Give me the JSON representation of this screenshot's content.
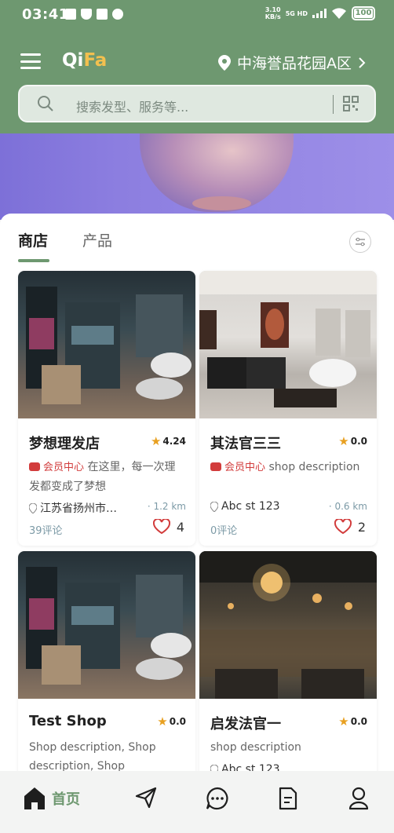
{
  "status_bar": {
    "time": "03:41",
    "net_speed_value": "3.10",
    "net_speed_unit": "KB/s",
    "signal_label": "5G HD",
    "battery": "100"
  },
  "header": {
    "logo_part1": "Qi",
    "logo_part2": "Fa",
    "location": "中海誉品花园A区",
    "search_placeholder": "搜索发型、服务等..."
  },
  "tabs": [
    {
      "label": "商店",
      "active": true
    },
    {
      "label": "产品",
      "active": false
    }
  ],
  "shops": [
    {
      "name": "梦想理发店",
      "rating": "4.24",
      "member_label": "会员中心",
      "description": "在这里，每一次理发都变成了梦想",
      "address": "江苏省扬州市…",
      "distance": "· 1.2 km",
      "reviews": "39评论",
      "likes": "4"
    },
    {
      "name": "其法官三三",
      "rating": "0.0",
      "member_label": "会员中心",
      "description": "shop description",
      "address": "Abc st 123",
      "distance": "· 0.6 km",
      "reviews": "0评论",
      "likes": "2"
    },
    {
      "name": "Test Shop",
      "rating": "0.0",
      "description": "Shop description, Shop description, Shop"
    },
    {
      "name": "启发法官一",
      "rating": "0.0",
      "description": "shop description",
      "address": "Abc st 123"
    }
  ],
  "bottom_nav": {
    "home_label": "首页"
  },
  "colors": {
    "primary": "#6e9870",
    "accent": "#f2c04f",
    "member_red": "#d23c3c"
  }
}
